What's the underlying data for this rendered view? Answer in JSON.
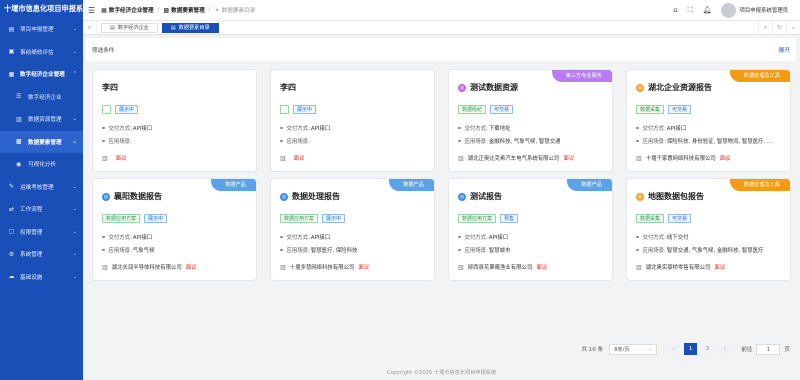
{
  "app": {
    "title": "十堰市信息化项目申报系统"
  },
  "sidebar": {
    "items": [
      {
        "label": "项目申报管理",
        "icon": "document-icon"
      },
      {
        "label": "事前绩效评估",
        "icon": "clipboard-icon"
      },
      {
        "label": "数字经济企业管理",
        "icon": "building-icon",
        "expanded": true,
        "children": [
          {
            "label": "数字经济企业",
            "icon": "list-icon"
          },
          {
            "label": "数据资源管理",
            "icon": "chart-icon"
          },
          {
            "label": "数据要素管理",
            "icon": "grid-icon",
            "current": true
          },
          {
            "label": "可视化分析",
            "icon": "eye-icon"
          }
        ]
      },
      {
        "label": "运维考核管理",
        "icon": "wrench-icon"
      },
      {
        "label": "工作流程",
        "icon": "flow-icon"
      },
      {
        "label": "权限管理",
        "icon": "lock-icon"
      },
      {
        "label": "系统管理",
        "icon": "gear-icon"
      },
      {
        "label": "基础设施",
        "icon": "server-icon"
      }
    ]
  },
  "header": {
    "breadcrumb": [
      "数字经济企业管理",
      "数据要素管理",
      "数据要素目录"
    ],
    "user_name": "项目申报系统管理员"
  },
  "tabs": [
    {
      "label": "数字经济企业",
      "active": false
    },
    {
      "label": "数据要素目录",
      "active": true
    }
  ],
  "filter": {
    "title": "筛选条件",
    "expand_label": "展开"
  },
  "cards": [
    {
      "title": "李四",
      "icon": "",
      "ribbon": "",
      "ribbon_color": "",
      "tags": [
        {
          "label": "",
          "color": "empty"
        },
        {
          "label": "展示中",
          "color": "blue"
        }
      ],
      "delivery_label": "交付方式:",
      "delivery": "API接口",
      "scene_label": "应用场景:",
      "scene": "",
      "company": "",
      "objection": "面议"
    },
    {
      "title": "李四",
      "icon": "",
      "ribbon": "",
      "ribbon_color": "",
      "tags": [
        {
          "label": "",
          "color": "empty"
        },
        {
          "label": "展示中",
          "color": "blue"
        }
      ],
      "delivery_label": "交付方式:",
      "delivery": "API接口",
      "scene_label": "应用场景:",
      "scene": "",
      "company": "",
      "objection": "面议"
    },
    {
      "title": "测试数据资源",
      "icon": "purple",
      "ribbon": "第三方专业服务",
      "ribbon_color": "purple",
      "tags": [
        {
          "label": "数据经纪",
          "color": "green"
        },
        {
          "label": "可交易",
          "color": "blue"
        }
      ],
      "delivery_label": "交付方式:",
      "delivery": "下载地址",
      "scene_label": "应用场景:",
      "scene": "金融科技, 气象气候, 智慧交通",
      "company": "湖北正奥比克希汽车电气系统有限公司",
      "objection": "面议"
    },
    {
      "title": "湖北企业资源报告",
      "icon": "orange",
      "ribbon": "数据处理及工具",
      "ribbon_color": "orange",
      "tags": [
        {
          "label": "数据采集",
          "color": "green"
        },
        {
          "label": "可交易",
          "color": "blue"
        }
      ],
      "delivery_label": "交付方式:",
      "delivery": "API接口",
      "scene_label": "应用场景:",
      "scene": "保险科技, 身份验证, 智慧物流, 智慧医疗, …",
      "company": "十堰千家惠网络科技有限公司",
      "objection": "面议"
    },
    {
      "title": "襄阳数据报告",
      "icon": "blue",
      "ribbon": "数据产品",
      "ribbon_color": "blue",
      "tags": [
        {
          "label": "数据应用方案",
          "color": "green"
        },
        {
          "label": "展示中",
          "color": "blue"
        }
      ],
      "delivery_label": "交付方式:",
      "delivery": "API接口",
      "scene_label": "应用场景:",
      "scene": "气象气候",
      "company": "湖北长润半导体科技有限公司",
      "objection": "面议"
    },
    {
      "title": "数据处理报告",
      "icon": "blue",
      "ribbon": "数据产品",
      "ribbon_color": "blue",
      "tags": [
        {
          "label": "数据应用方案",
          "color": "green"
        },
        {
          "label": "展示中",
          "color": "blue"
        }
      ],
      "delivery_label": "交付方式:",
      "delivery": "API接口",
      "scene_label": "应用场景:",
      "scene": "智慧医疗, 保险科技",
      "company": "十堰多慧网络科技有限公司",
      "objection": "面议"
    },
    {
      "title": "测试报告",
      "icon": "blue",
      "ribbon": "数据产品",
      "ribbon_color": "blue",
      "tags": [
        {
          "label": "数据应用方案",
          "color": "green"
        },
        {
          "label": "预售",
          "color": "blue"
        }
      ],
      "delivery_label": "交付方式:",
      "delivery": "API接口",
      "scene_label": "应用场景:",
      "scene": "智慧城市",
      "company": "郧西县花果庵渔业有限公司",
      "objection": "面议"
    },
    {
      "title": "地图数据包报告",
      "icon": "orange",
      "ribbon": "数据处理及工具",
      "ribbon_color": "orange",
      "tags": [
        {
          "label": "数据采集",
          "color": "green"
        },
        {
          "label": "可交易",
          "color": "blue"
        }
      ],
      "delivery_label": "交付方式:",
      "delivery": "线下交付",
      "scene_label": "应用场景:",
      "scene": "智慧交通, 气象气候, 金融科技, 智慧医疗",
      "company": "湖北奥实豪桥零售有限公司",
      "objection": "面议"
    }
  ],
  "pagination": {
    "total": "共 10 条",
    "page_size": "8条/页",
    "pages": [
      "1",
      "2"
    ],
    "current": "1",
    "goto_label": "前往",
    "goto_value": "1",
    "page_suffix": "页"
  },
  "footer": {
    "copyright": "Copyright ©2025 十堰市信息化项目申报系统"
  },
  "colors": {
    "primary": "#1a4fb8",
    "objection": "#e0281f",
    "ribbon_purple": "#b77cf0",
    "ribbon_orange": "#f39c12",
    "ribbon_blue": "#5aa3e8"
  }
}
